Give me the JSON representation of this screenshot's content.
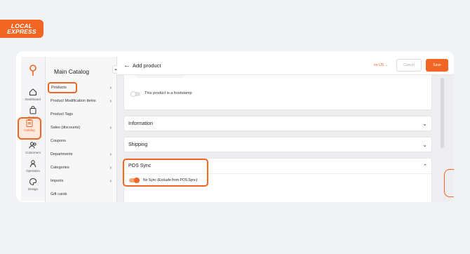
{
  "brand": {
    "logo_line1": "LOCAL",
    "logo_line2": "EXPRESS"
  },
  "rail": [
    {
      "label": "Dashboard",
      "icon": "home-icon"
    },
    {
      "label": "Orders",
      "icon": "bag-icon"
    },
    {
      "label": "Catalog",
      "icon": "clipboard-icon",
      "active": true
    },
    {
      "label": "Customers",
      "icon": "people-icon"
    },
    {
      "label": "Operation",
      "icon": "gear-person-icon"
    },
    {
      "label": "Design",
      "icon": "palette-icon"
    }
  ],
  "catalog_menu": {
    "title": "Main Catalog",
    "items": [
      {
        "label": "Products",
        "chevron": true
      },
      {
        "label": "Product Modification Items",
        "chevron": true
      },
      {
        "label": "Product Tags",
        "chevron": false
      },
      {
        "label": "Sales (discounts)",
        "chevron": true
      },
      {
        "label": "Coupons",
        "chevron": false
      },
      {
        "label": "Departments",
        "chevron": true
      },
      {
        "label": "Categories",
        "chevron": true
      },
      {
        "label": "Imports",
        "chevron": true
      },
      {
        "label": "Gift cards",
        "chevron": false
      }
    ]
  },
  "topbar": {
    "title": "Add product",
    "locale": "en-US",
    "cancel_label": "Cancel",
    "save_label": "Save"
  },
  "form": {
    "foodstamp_label": "This product is a foodstamp",
    "foodstamp_on": false,
    "sections": {
      "information": "Information",
      "shipping": "Shipping",
      "pos_sync": "POS Sync"
    },
    "pos_sync_option": "No Sync (Exclude from POS Sync)",
    "pos_sync_on": true
  },
  "colors": {
    "accent": "#f26522"
  }
}
